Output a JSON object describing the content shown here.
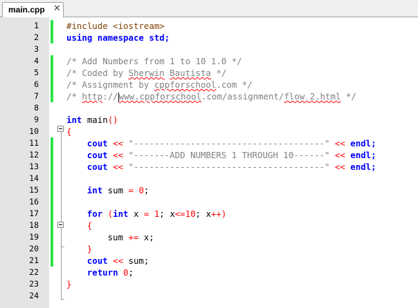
{
  "tab": {
    "label": "main.cpp",
    "close_glyph": "✕",
    "close_icon": "close-icon"
  },
  "code": {
    "l1": [
      "#include <iostream>"
    ],
    "l2": [
      "using namespace std;"
    ],
    "l4": [
      "/* Add Numbers from 1 to 10 1.0 */"
    ],
    "l5": [
      "/* Coded by ",
      "Sherwin",
      " ",
      "Bautista",
      " */"
    ],
    "l6": [
      "/* Assignment by ",
      "cppforschool",
      ".com */"
    ],
    "l7": [
      "/* ",
      "http",
      "://",
      "www.cppforschool",
      ".com/assignment/",
      "flow_2.html",
      " */"
    ],
    "l9": [
      "int",
      " main",
      "()"
    ],
    "l10": [
      "{"
    ],
    "l11": [
      "cout",
      " << ",
      "\"-------------------------------------\"",
      " << ",
      "endl;"
    ],
    "l12": [
      "cout",
      " << ",
      "\"-------ADD NUMBERS 1 THROUGH 10------\"",
      " << ",
      "endl;"
    ],
    "l13": [
      "cout",
      " << ",
      "\"-------------------------------------\"",
      " << ",
      "endl;"
    ],
    "l15": [
      "int",
      " sum ",
      "=",
      " ",
      "0",
      ";"
    ],
    "l17": [
      "for",
      " (",
      "int",
      " x ",
      "=",
      " ",
      "1",
      "; x",
      "<=",
      "10",
      "; x",
      "++",
      ")"
    ],
    "l18": [
      "{"
    ],
    "l19": [
      "sum ",
      "+=",
      " x;"
    ],
    "l20": [
      "}"
    ],
    "l21": [
      "cout",
      " ",
      "<<",
      " sum;"
    ],
    "l22": [
      "return",
      " ",
      "0",
      ";"
    ],
    "l23": [
      "}"
    ]
  },
  "line_numbers": [
    "1",
    "2",
    "3",
    "4",
    "5",
    "6",
    "7",
    "8",
    "9",
    "10",
    "11",
    "12",
    "13",
    "14",
    "15",
    "16",
    "17",
    "18",
    "19",
    "20",
    "21",
    "22",
    "23",
    "24"
  ],
  "colors": {
    "gutter": "#e4e4e4",
    "change_marker": "#2ee34b",
    "keyword": "#0000ff",
    "comment": "#808080",
    "operator": "#ff0000",
    "preprocessor": "#804000"
  }
}
